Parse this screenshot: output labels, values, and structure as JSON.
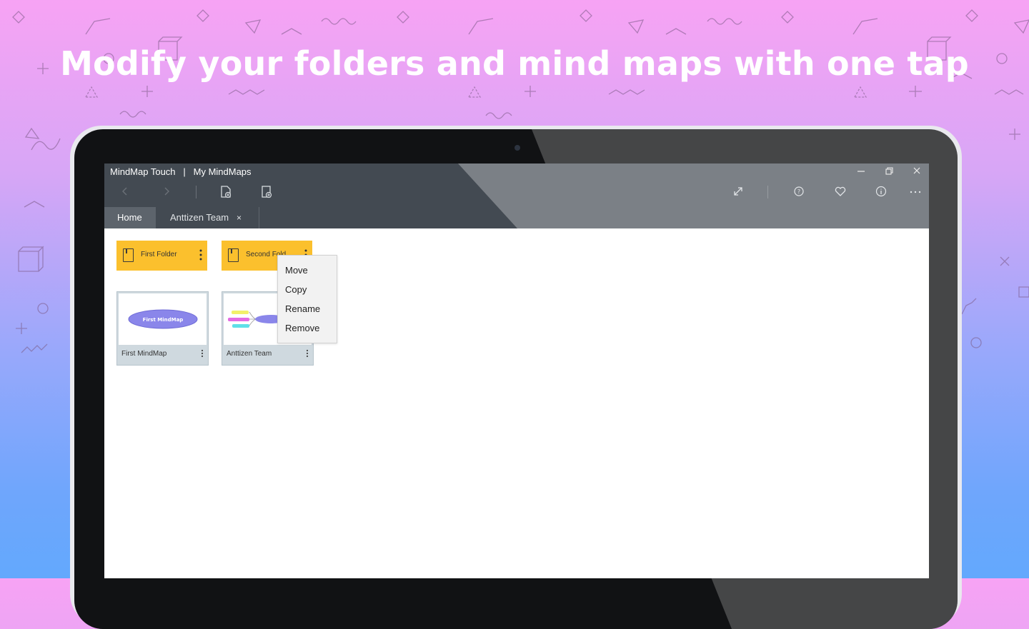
{
  "headline": "Modify your folders and mind maps with one tap",
  "window": {
    "app_name": "MindMap Touch",
    "separator": "|",
    "page_title": "My MindMaps",
    "minimize_icon": "minimize-icon",
    "restore_icon": "restore-icon",
    "close_icon": "close-icon"
  },
  "toolbar": {
    "back": "back-arrow-icon",
    "forward": "forward-arrow-icon",
    "new_map": "new-mindmap-icon",
    "new_folder": "new-folder-icon",
    "expand": "expand-icon",
    "help": "help-icon",
    "favorite": "heart-icon",
    "info": "info-icon",
    "more": "more-icon"
  },
  "tabs": [
    {
      "label": "Home",
      "active": true
    },
    {
      "label": "Anttizen Team",
      "active": false,
      "close": "×"
    }
  ],
  "folders": [
    {
      "label": "First Folder"
    },
    {
      "label": "Second Fold"
    }
  ],
  "mindmaps": [
    {
      "label": "First MindMap",
      "thumb_text": "First MindMap"
    },
    {
      "label": "Anttizen Team"
    }
  ],
  "context_menu": {
    "items": [
      "Move",
      "Copy",
      "Rename",
      "Remove"
    ]
  },
  "colors": {
    "folder": "#fbc02d",
    "titlebar": "#434a52",
    "node": "#8a86ea"
  }
}
